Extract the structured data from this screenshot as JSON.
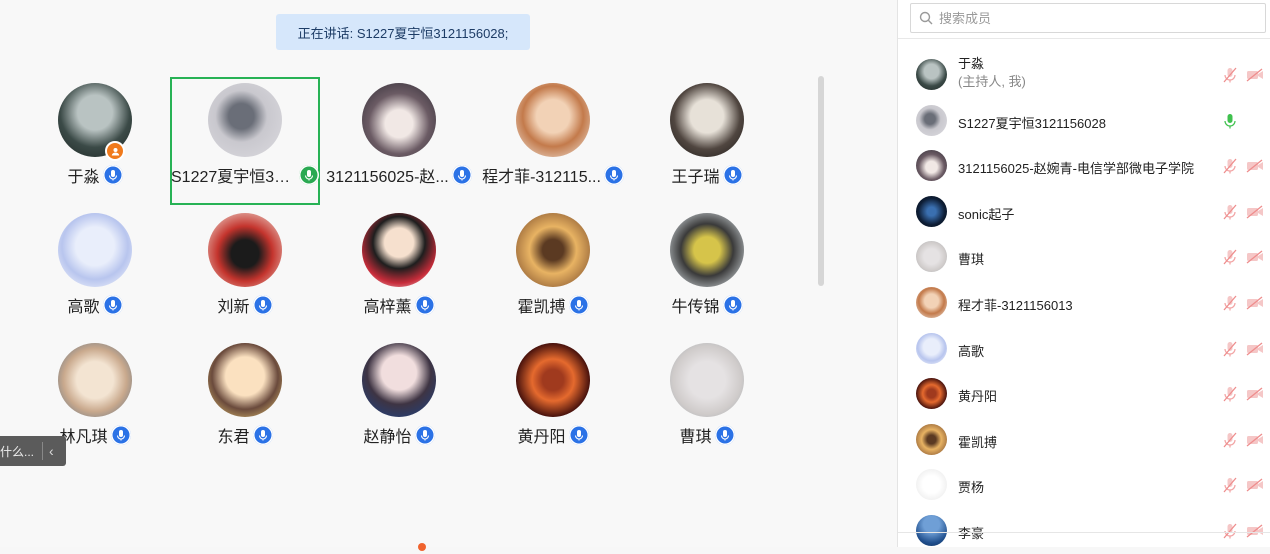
{
  "stage": {
    "speaking_banner": "正在讲话: S1227夏宇恒3121156028;",
    "side_tab_text": "什么...",
    "side_tab_icon": "chevron-left-icon",
    "participants": [
      {
        "name": "于淼",
        "mic": "blue",
        "host": true
      },
      {
        "name": "S1227夏宇恒31...",
        "mic": "green",
        "active": true
      },
      {
        "name": "3121156025-赵...",
        "mic": "blue"
      },
      {
        "name": "程才菲-312115...",
        "mic": "blue"
      },
      {
        "name": "王子瑞",
        "mic": "blue"
      },
      {
        "name": "高歌",
        "mic": "blue"
      },
      {
        "name": "刘新",
        "mic": "blue"
      },
      {
        "name": "高梓薰",
        "mic": "blue"
      },
      {
        "name": "霍凯搏",
        "mic": "blue"
      },
      {
        "name": "牛传锦",
        "mic": "blue"
      },
      {
        "name": "林凡琪",
        "mic": "blue"
      },
      {
        "name": "东君",
        "mic": "blue"
      },
      {
        "name": "赵静怡",
        "mic": "blue"
      },
      {
        "name": "黄丹阳",
        "mic": "blue"
      },
      {
        "name": "曹琪",
        "mic": "blue"
      }
    ]
  },
  "panel": {
    "search_placeholder": "搜索成员",
    "members": [
      {
        "name": "于淼",
        "sub": "(主持人, 我)",
        "mic": "muted"
      },
      {
        "name": "S1227夏宇恒3121156028",
        "mic": "talking"
      },
      {
        "name": "3121156025-赵婉青-电信学部微电子学院",
        "mic": "muted"
      },
      {
        "name": "sonic起子",
        "mic": "muted"
      },
      {
        "name": "曹琪",
        "mic": "muted"
      },
      {
        "name": "程才菲-3121156013",
        "mic": "muted"
      },
      {
        "name": "高歌",
        "mic": "muted"
      },
      {
        "name": "黄丹阳",
        "mic": "muted"
      },
      {
        "name": "霍凯搏",
        "mic": "muted"
      },
      {
        "name": "贾杨",
        "mic": "muted"
      },
      {
        "name": "李豪",
        "mic": "muted"
      }
    ]
  },
  "colors": {
    "mic_blue": "#2b72e6",
    "mic_green": "#2aa952",
    "active_border": "#27b255",
    "muted_red": "#f2a4a4",
    "host_badge": "#f07a1c",
    "banner_bg": "#d6e7fb"
  }
}
